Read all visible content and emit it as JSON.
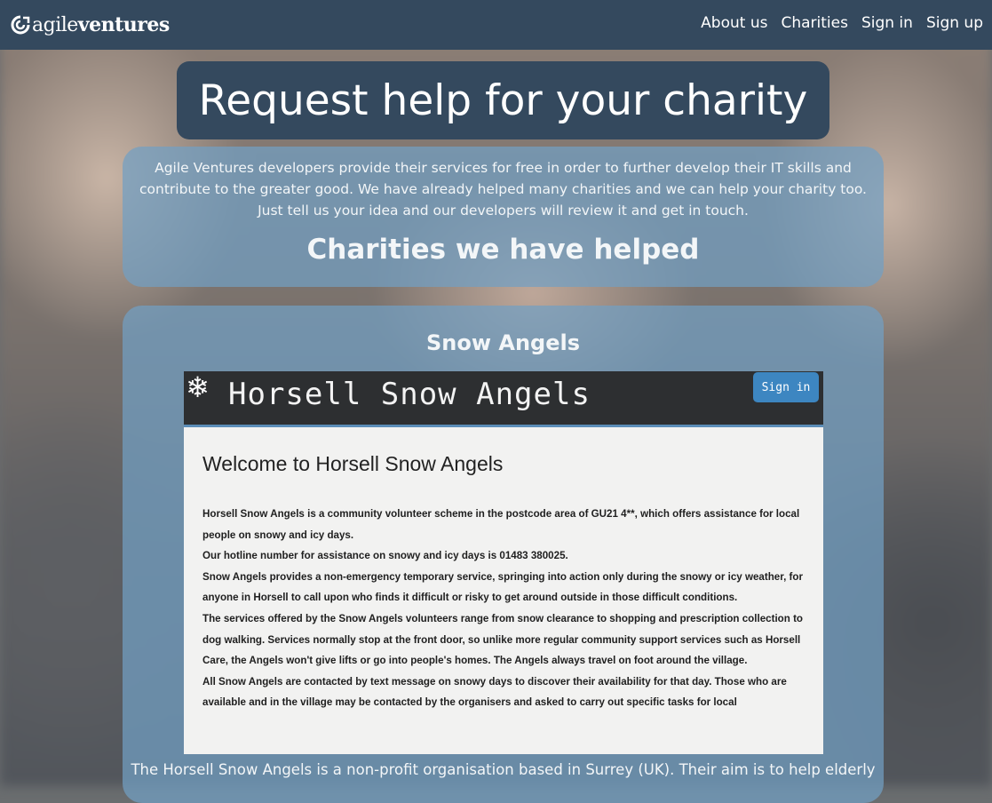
{
  "navbar": {
    "logo": {
      "light": "agile",
      "bold": "ventures",
      "icon": "agile-ventures-logo-icon"
    },
    "links": [
      "About us",
      "Charities",
      "Sign in",
      "Sign up"
    ]
  },
  "page": {
    "title": "Request help for your charity",
    "intro": "Agile Ventures developers provide their services for free in order to further develop their IT skills and contribute to the greater good. We have already helped many charities and we can help your charity too. Just tell us your idea and our developers will review it and get in touch.",
    "helped_heading": "Charities we have helped"
  },
  "charities": [
    {
      "name": "Snow Angels",
      "screenshot": {
        "icon": "snowflake-icon",
        "site_title": "Horsell Snow Angels",
        "signin_label": "Sign in",
        "heading": "Welcome to Horsell Snow Angels",
        "paragraphs": [
          "Horsell Snow Angels is a community volunteer scheme in the postcode area of GU21 4**, which offers assistance for local people on snowy and icy days.",
          "Our hotline number for assistance on snowy and icy days is 01483 380025.",
          "Snow Angels provides a non-emergency temporary service, springing into action only during the snowy or icy weather, for anyone in Horsell to call upon who finds it difficult or risky to get around outside in those difficult conditions.",
          "The services offered by the Snow Angels volunteers range from snow clearance to shopping and prescription collection to dog walking. Services normally stop at the front door, so unlike more regular community support services such as Horsell Care, the Angels won't give lifts or go into people's homes. The Angels always travel on foot around the village.",
          "All Snow Angels are contacted by text message on snowy days to discover their availability for that day. Those who are available and in the village may be contacted by the organisers and asked to carry out specific tasks for local"
        ]
      },
      "description": "The Horsell Snow Angels is a non-profit organisation based in Surrey (UK). Their aim is to help elderly"
    }
  ],
  "colors": {
    "navbar": "#34495e",
    "panel": "#71a0c4",
    "button": "#3d86c1"
  }
}
